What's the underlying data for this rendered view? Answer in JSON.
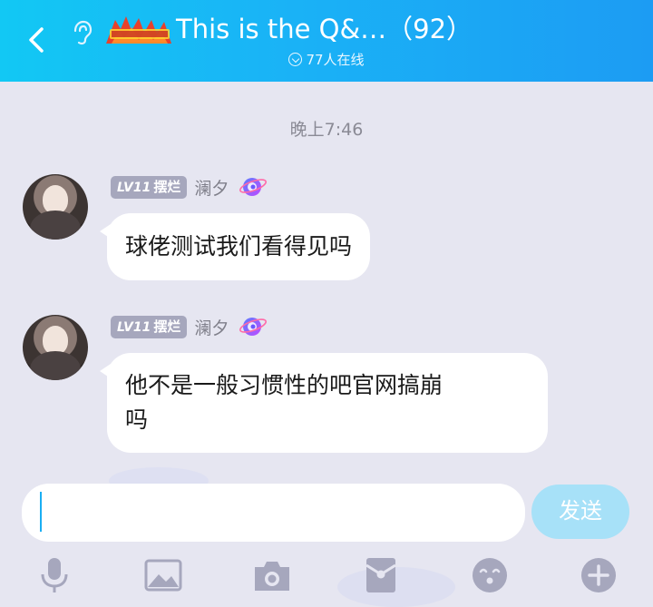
{
  "header": {
    "title": "This is the Q&…（92）",
    "online_count": "77人在线",
    "bg_color": "#1ab2f6"
  },
  "chat": {
    "timestamp": "晚上7:46",
    "messages": [
      {
        "level": "LV11",
        "tag": "摆烂",
        "nickname": "澜夕",
        "text": "球佬测试我们看得见吗"
      },
      {
        "level": "LV11",
        "tag": "摆烂",
        "nickname": "澜夕",
        "text_line1": "他不是一般习惯性的吧官网搞崩",
        "text_line2": "吗"
      }
    ]
  },
  "input": {
    "value": "",
    "send_label": "发送"
  },
  "toolbar": {
    "icons": [
      "microphone-icon",
      "image-icon",
      "camera-icon",
      "red-packet-icon",
      "emoji-icon",
      "plus-icon"
    ]
  }
}
